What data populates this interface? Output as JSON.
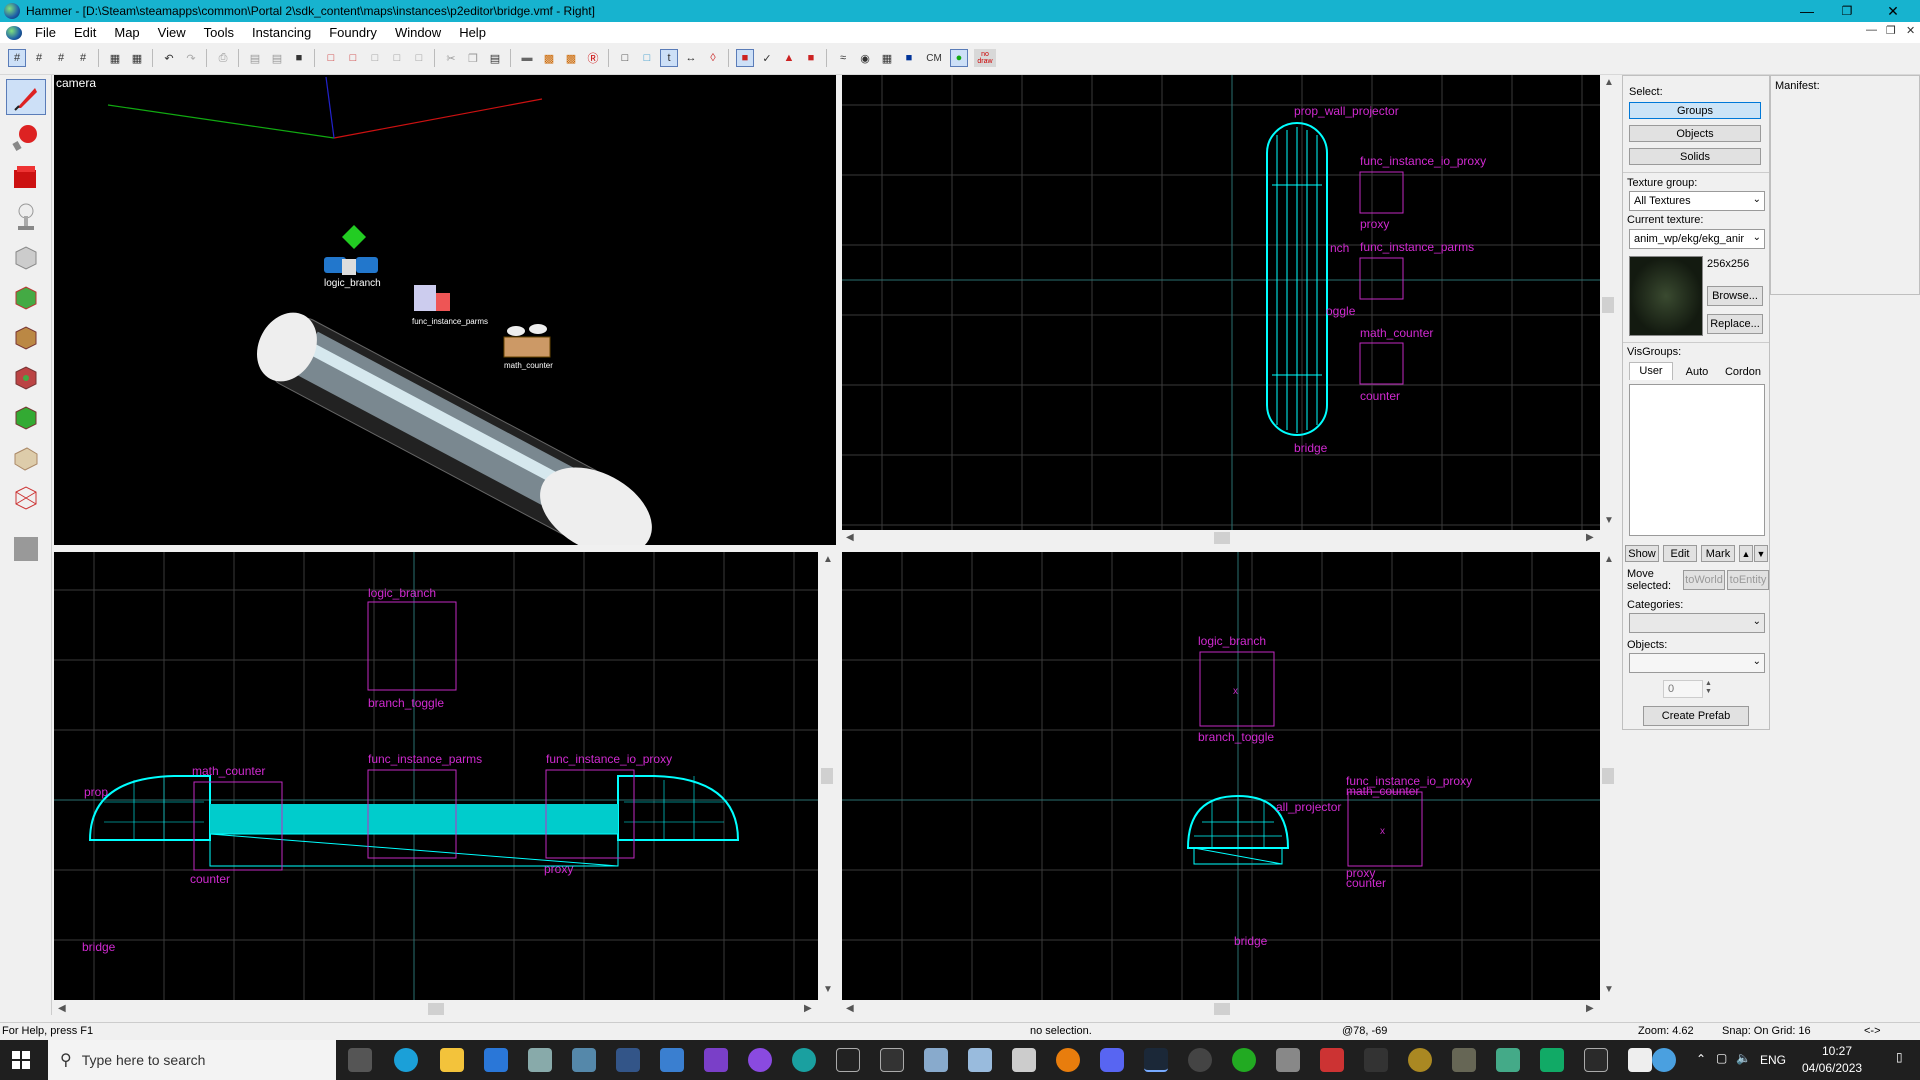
{
  "window": {
    "title": "Hammer - [D:\\Steam\\steamapps\\common\\Portal 2\\sdk_content\\maps\\instances\\p2editor\\bridge.vmf - Right]",
    "minimize": "—",
    "maximize": "❐",
    "close": "✕"
  },
  "menu": [
    "File",
    "Edit",
    "Map",
    "View",
    "Tools",
    "Instancing",
    "Foundry",
    "Window",
    "Help"
  ],
  "toolbar": {
    "cm_label": "CM",
    "no_draw_label": "no draw"
  },
  "views": {
    "camera": {
      "label": "camera",
      "entities": [
        "logic_branch",
        "func_instance_parms",
        "math_counter"
      ]
    },
    "top_right": {
      "labels": [
        "prop_wall_projector",
        "func_instance_io_proxy",
        "proxy",
        "nch",
        "func_instance_parms",
        "oggle",
        "math_counter",
        "counter",
        "bridge"
      ]
    },
    "bottom_left": {
      "labels": [
        "logic_branch",
        "branch_toggle",
        "math_counter",
        "prop",
        "func_instance_parms",
        "func_instance_io_proxy",
        "counter",
        "proxy",
        "bridge"
      ]
    },
    "bottom_right": {
      "labels": [
        "logic_branch",
        "branch_toggle",
        "func_instance_io_proxy",
        "math_counter",
        "all_projector",
        "proxy",
        "counter",
        "bridge"
      ]
    }
  },
  "panel": {
    "select_label": "Select:",
    "groups": "Groups",
    "objects": "Objects",
    "solids": "Solids",
    "texture_group_label": "Texture group:",
    "texture_group_value": "All Textures",
    "current_texture_label": "Current texture:",
    "current_texture_value": "anim_wp/ekg/ekg_anir",
    "texture_size": "256x256",
    "browse": "Browse...",
    "replace": "Replace...",
    "visgroups_label": "VisGroups:",
    "tabs": [
      "User",
      "Auto",
      "Cordon"
    ],
    "show": "Show",
    "edit": "Edit",
    "mark": "Mark",
    "move_selected_label": "Move selected:",
    "to_world": "toWorld",
    "to_entity": "toEntity",
    "categories_label": "Categories:",
    "objects_label": "Objects:",
    "count_value": "0",
    "create_prefab": "Create Prefab"
  },
  "manifest": {
    "label": "Manifest:"
  },
  "status": {
    "help": "For Help, press F1",
    "selection": "no selection.",
    "coords": "@78, -69",
    "zoom": "Zoom: 4.62",
    "snap": "Snap: On Grid: 16",
    "arrows": "<->"
  },
  "taskbar": {
    "search_placeholder": "Type here to search",
    "lang": "ENG",
    "time": "10:27",
    "date": "04/06/2023"
  }
}
